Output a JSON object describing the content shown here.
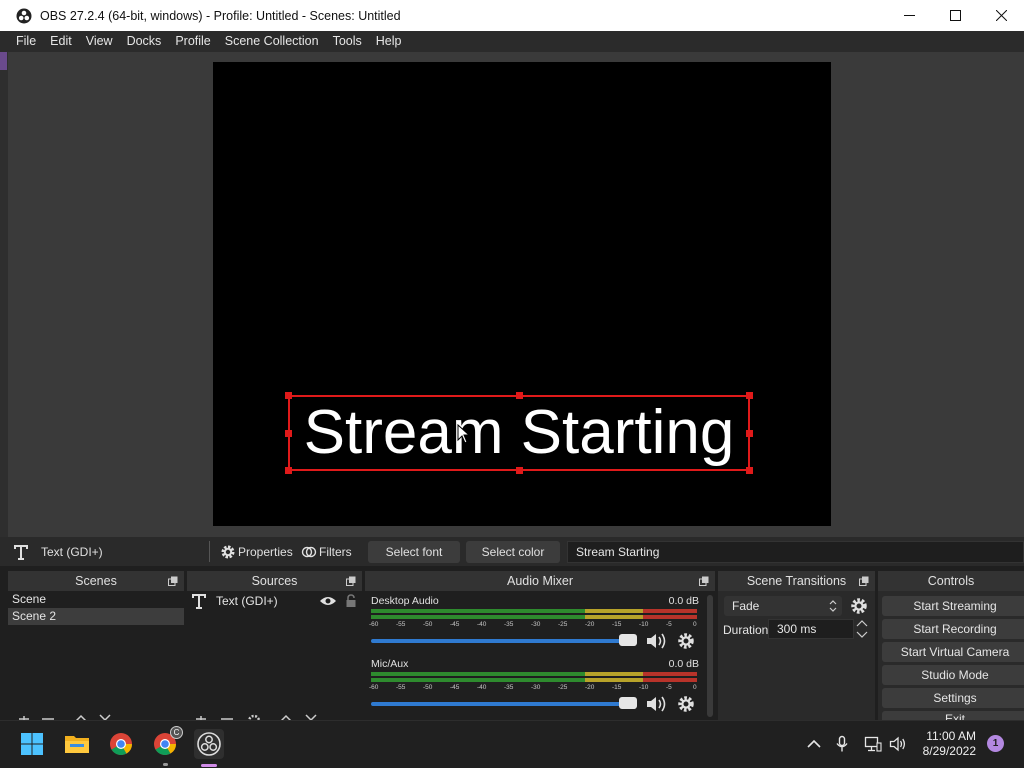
{
  "window": {
    "title": "OBS 27.2.4 (64-bit, windows) - Profile: Untitled - Scenes: Untitled"
  },
  "menu": [
    "File",
    "Edit",
    "View",
    "Docks",
    "Profile",
    "Scene Collection",
    "Tools",
    "Help"
  ],
  "preview": {
    "source_text": "Stream Starting"
  },
  "source_toolbar": {
    "selected_source": "Text (GDI+)",
    "properties_label": "Properties",
    "filters_label": "Filters",
    "select_font_label": "Select font",
    "select_color_label": "Select color",
    "text_value": "Stream Starting"
  },
  "docks": {
    "scenes": {
      "title": "Scenes",
      "items": [
        "Scene",
        "Scene 2"
      ],
      "selected_index": 1
    },
    "sources": {
      "title": "Sources",
      "items": [
        "Text (GDI+)"
      ]
    },
    "audio_mixer": {
      "title": "Audio Mixer",
      "ticks": [
        "-60",
        "-55",
        "-50",
        "-45",
        "-40",
        "-35",
        "-30",
        "-25",
        "-20",
        "-15",
        "-10",
        "-5",
        "0"
      ],
      "channels": [
        {
          "name": "Desktop Audio",
          "db": "0.0 dB",
          "volume": 1.0
        },
        {
          "name": "Mic/Aux",
          "db": "0.0 dB",
          "volume": 1.0
        }
      ]
    },
    "scene_transitions": {
      "title": "Scene Transitions",
      "transition": "Fade",
      "duration_label": "Duration",
      "duration_value": "300 ms"
    },
    "controls": {
      "title": "Controls",
      "buttons": [
        "Start Streaming",
        "Start Recording",
        "Start Virtual Camera",
        "Studio Mode",
        "Settings",
        "Exit"
      ]
    }
  },
  "taskbar": {
    "time": "11:00 AM",
    "date": "8/29/2022",
    "notification_count": "1",
    "chrome_badge": "C"
  },
  "colors": {
    "selection_red": "#e01a1a",
    "meter_green": "#2e8b2e",
    "meter_yellow": "#b8a32a",
    "meter_red": "#b8332a",
    "slider_blue": "#2f7ad0"
  }
}
